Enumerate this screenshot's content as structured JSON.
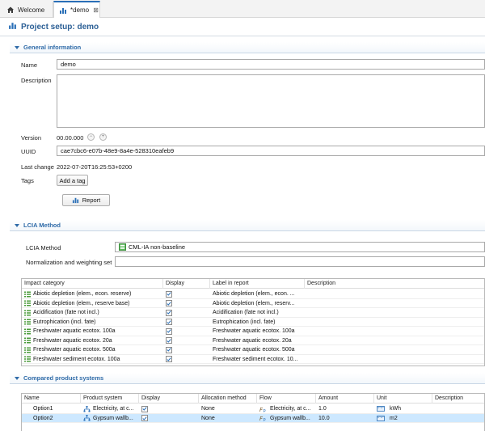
{
  "tabs": [
    {
      "label": "Welcome",
      "icon": "home-icon"
    },
    {
      "label": "*demo",
      "icon": "bar-chart-icon",
      "close": "⊠"
    }
  ],
  "editor_title": "Project setup: demo",
  "general": {
    "header": "General information",
    "name_label": "Name",
    "name_value": "demo",
    "description_label": "Description",
    "description_value": "",
    "version_label": "Version",
    "version_value": "00.00.000",
    "uuid_label": "UUID",
    "uuid_value": "cae7cbc6-e07b-48e9-8a4e-528310eafeb9",
    "last_change_label": "Last change",
    "last_change_value": "2022-07-20T16:25:53+0200",
    "tags_label": "Tags",
    "add_tag_label": "Add a tag",
    "report_label": "Report"
  },
  "lcia": {
    "header": "LCIA Method",
    "method_label": "LCIA Method",
    "method_value": "CML-IA non-baseline",
    "nw_label": "Normalization and weighting set",
    "nw_value": "",
    "columns": [
      "Impact category",
      "Display",
      "Label in report",
      "Description"
    ],
    "rows": [
      {
        "category": "Abiotic depletion (elem., econ. reserve)",
        "display": true,
        "label": "Abiotic depletion (elem., econ. ...",
        "description": ""
      },
      {
        "category": "Abiotic depletion (elem., reserve base)",
        "display": true,
        "label": "Abiotic depletion (elem., reserv...",
        "description": ""
      },
      {
        "category": "Acidification (fate not incl.)",
        "display": true,
        "label": "Acidification (fate not incl.)",
        "description": ""
      },
      {
        "category": "Eutrophication (incl. fate)",
        "display": true,
        "label": "Eutrophication (incl. fate)",
        "description": ""
      },
      {
        "category": "Freshwater aquatic ecotox. 100a",
        "display": true,
        "label": "Freshwater aquatic ecotox. 100a",
        "description": ""
      },
      {
        "category": "Freshwater aquatic ecotox. 20a",
        "display": true,
        "label": "Freshwater aquatic ecotox. 20a",
        "description": ""
      },
      {
        "category": "Freshwater aquatic ecotox. 500a",
        "display": true,
        "label": "Freshwater aquatic ecotox. 500a",
        "description": ""
      },
      {
        "category": "Freshwater sediment ecotox. 100a",
        "display": true,
        "label": "Freshwater sediment ecotox. 10...",
        "description": ""
      }
    ]
  },
  "compared": {
    "header": "Compared product systems",
    "columns": [
      "Name",
      "Product system",
      "Display",
      "Allocation method",
      "Flow",
      "Amount",
      "Unit",
      "Description"
    ],
    "rows": [
      {
        "name": "Option1",
        "system": "Electricity, at c...",
        "display": true,
        "allocation": "None",
        "flow": "Electricity, at c...",
        "amount": "1.0",
        "unit": "kWh",
        "description": "",
        "selected": false
      },
      {
        "name": "Option2",
        "system": "Gypsum wallb...",
        "display": true,
        "allocation": "None",
        "flow": "Gypsum wallb...",
        "amount": "10.0",
        "unit": "m2",
        "description": "",
        "selected": true
      }
    ]
  },
  "colors": {
    "accent": "#2f6ba8",
    "selection": "#cde8ff"
  }
}
